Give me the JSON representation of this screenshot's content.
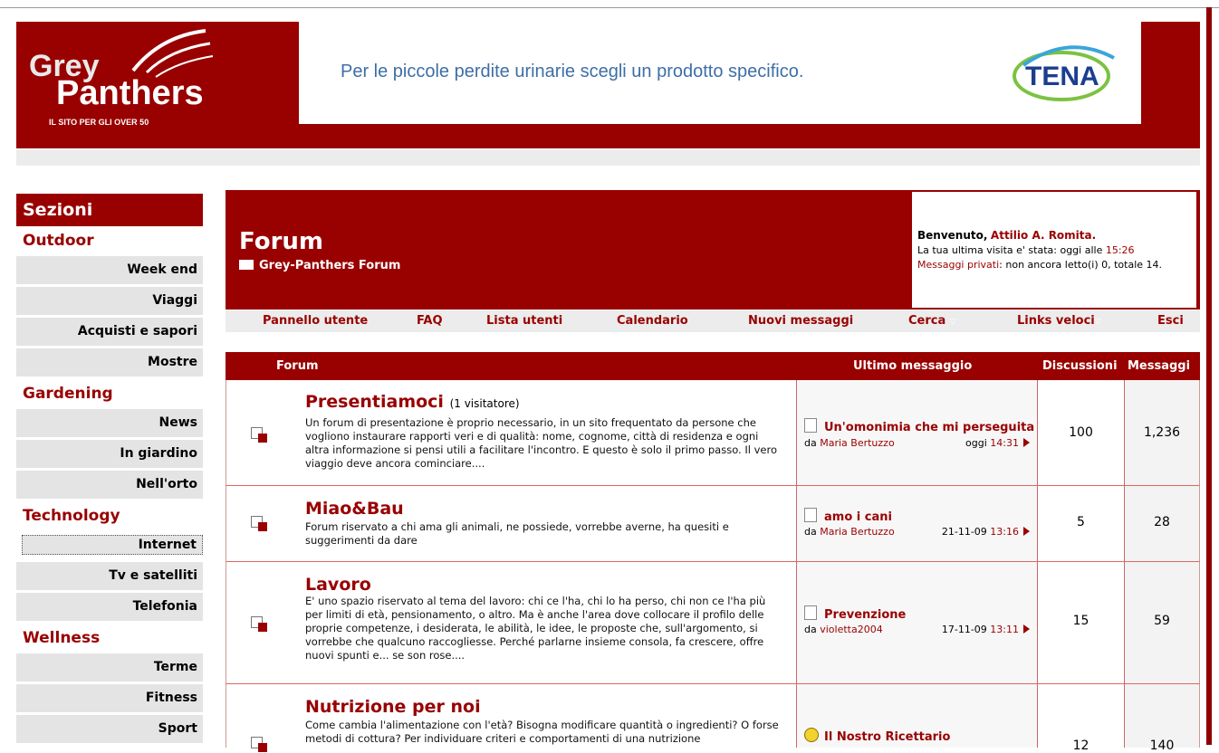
{
  "logo": {
    "line1": "Grey",
    "line2": "Panthers",
    "tagline": "IL SITO PER GLI OVER 50"
  },
  "banner": {
    "text": "Per le piccole perdite urinarie scegli un prodotto specifico.",
    "brand": "TENA"
  },
  "sidebar": {
    "title": "Sezioni",
    "groups": [
      {
        "label": "Outdoor",
        "items": [
          "Week end",
          "Viaggi",
          "Acquisti e sapori",
          "Mostre"
        ]
      },
      {
        "label": "Gardening",
        "items": [
          "News",
          "In giardino",
          "Nell'orto"
        ]
      },
      {
        "label": "Technology",
        "items": [
          "Internet",
          "Tv e satelliti",
          "Telefonia"
        ]
      },
      {
        "label": "Wellness",
        "items": [
          "Terme",
          "Fitness",
          "Sport"
        ]
      }
    ]
  },
  "forum_header": {
    "title": "Forum",
    "breadcrumb": "Grey-Panthers Forum",
    "welcome_prefix": "Benvenuto,",
    "user": "Attilio A. Romita.",
    "last_visit_label": "La tua ultima visita e' stata: oggi alle",
    "last_visit_time": "15:26",
    "pm_label": "Messaggi privati",
    "pm_text": ": non ancora letto(i) 0, totale 14."
  },
  "nav": [
    "Pannello utente",
    "FAQ",
    "Lista utenti",
    "Calendario",
    "Nuovi messaggi",
    "Cerca",
    "Links veloci",
    "Esci"
  ],
  "table": {
    "headers": {
      "forum": "Forum",
      "last": "Ultimo messaggio",
      "threads": "Discussioni",
      "posts": "Messaggi"
    },
    "rows": [
      {
        "name": "Presentiamoci",
        "viewers": "(1 visitatore)",
        "desc": "Un forum di presentazione è proprio necessario, in un sito frequentato da persone che vogliono instaurare rapporti veri e di qualità: nome, cognome, città di residenza e ogni altra informazione si pensi utili a facilitare l'incontro. E questo è solo il primo passo. Il vero viaggio deve ancora cominciare....",
        "last_title": "Un'omonimia che mi perseguita",
        "last_by_prefix": "da",
        "last_by": "Maria Bertuzzo",
        "last_date": "oggi",
        "last_time": "14:31",
        "threads": "100",
        "posts": "1,236"
      },
      {
        "name": "Miao&Bau",
        "viewers": "",
        "desc": "Forum riservato a chi ama gli animali, ne possiede, vorrebbe averne, ha quesiti e suggerimenti da dare",
        "last_title": "amo i cani",
        "last_by_prefix": "da",
        "last_by": "Maria Bertuzzo",
        "last_date": "21-11-09",
        "last_time": "13:16",
        "threads": "5",
        "posts": "28"
      },
      {
        "name": "Lavoro",
        "viewers": "",
        "desc": "E' uno spazio riservato al tema del lavoro: chi ce l'ha, chi lo ha perso, chi non ce l'ha più per limiti di età, pensionamento, o altro. Ma è anche l'area dove collocare il profilo delle proprie competenze, i desiderata, le abilità, le idee, le proposte che, sull'argomento, si vorrebbe che qualcuno raccogliesse. Perché parlarne insieme consola, fa crescere, offre nuovi spunti e... se son rose....",
        "last_title": "Prevenzione",
        "last_by_prefix": "da",
        "last_by": "violetta2004",
        "last_date": "17-11-09",
        "last_time": "13:11",
        "threads": "15",
        "posts": "59"
      },
      {
        "name": "Nutrizione per noi",
        "viewers": "",
        "desc": "Come cambia l'alimentazione con l'età? Bisogna modificare quantità o ingredienti? O forse metodi di cottura? Per individuare criteri e comportamenti di una nutrizione",
        "last_title": "Il Nostro Ricettario",
        "last_by_prefix": "",
        "last_by": "",
        "last_date": "",
        "last_time": "",
        "threads": "12",
        "posts": "140"
      }
    ]
  }
}
